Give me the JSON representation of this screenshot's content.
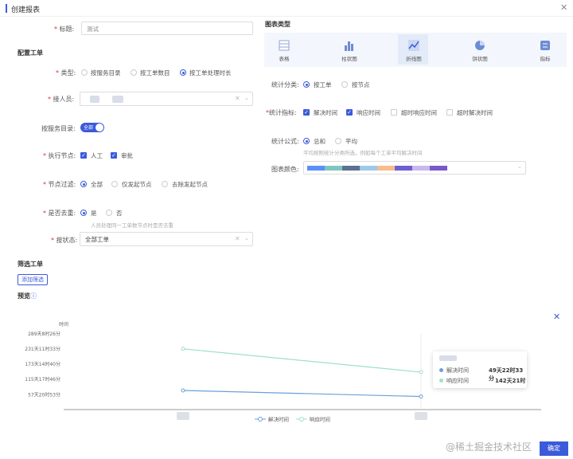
{
  "dialog": {
    "title": "创建报表"
  },
  "form": {
    "title_label": "标题:",
    "title_value": "测试",
    "section_config": "配置工单",
    "type_label": "类型:",
    "type_options": [
      "按服务目录",
      "按工单数目",
      "按工单处理时长"
    ],
    "assignee_label": "接人员:",
    "catalog_label": "按服务目录:",
    "catalog_toggle": "全部",
    "exec_node_label": "执行节点:",
    "exec_node_options": [
      "人工",
      "审批"
    ],
    "node_filter_label": "节点过滤:",
    "node_filter_options": [
      "全部",
      "仅发起节点",
      "去除发起节点"
    ],
    "dedupe_label": "是否去重:",
    "dedupe_options": [
      "是",
      "否"
    ],
    "dedupe_hint": "人员处理同一工单数节点时是否去重",
    "status_label": "按状态:",
    "status_value": "全部工单"
  },
  "chart_type": {
    "section": "图表类型",
    "types": [
      "表格",
      "柱状图",
      "折线图",
      "饼状图",
      "指标"
    ],
    "stat_category_label": "统计分类:",
    "stat_category_options": [
      "按工单",
      "按节点"
    ],
    "stat_metrics_label": "统计指标:",
    "stat_metrics_options": [
      "解决时间",
      "响应时间",
      "超时响应时间",
      "超时解决时间"
    ],
    "formula_label": "统计公式:",
    "formula_options": [
      "总和",
      "平均"
    ],
    "formula_hint": "平均按照统计分类所选，例如每个工单平均解决时间",
    "color_label": "图表颜色:",
    "palette": [
      "#5b8ff9",
      "#7fc6c0",
      "#5d7092",
      "#9cc9e8",
      "#f6bd8c",
      "#6e5fd2",
      "#c8b7f0",
      "#7a58c9"
    ]
  },
  "filter": {
    "section": "筛选工单",
    "add_button": "添加筛选"
  },
  "preview": {
    "label": "预览"
  },
  "chart_data": {
    "type": "line",
    "ylabel": "时间",
    "y_ticks": [
      "289天8时26分",
      "231天11时33分",
      "173天14时40分",
      "115天17时46分",
      "57天20时53分"
    ],
    "series": [
      {
        "name": "解决时间",
        "color": "#6aa0d8",
        "values": [
          73,
          50
        ]
      },
      {
        "name": "响应时间",
        "color": "#9fe0c8",
        "values": [
          232,
          143
        ]
      }
    ],
    "ylim": [
      0,
      289
    ],
    "tooltip": {
      "rows": [
        {
          "name": "解决时间",
          "value": "49天22时33分"
        },
        {
          "name": "响应时间",
          "value": "142天21时"
        }
      ]
    }
  },
  "footer": {
    "confirm": "确定",
    "watermark": "@稀土掘金技术社区"
  }
}
